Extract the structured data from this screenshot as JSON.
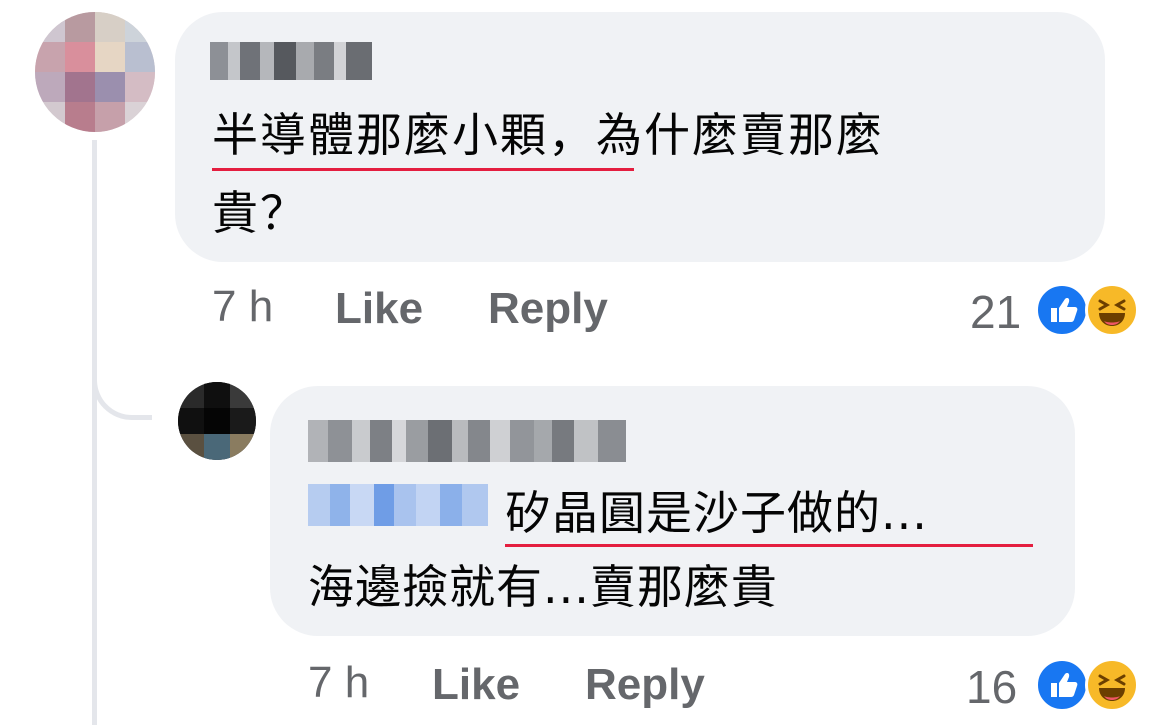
{
  "comment": {
    "text_line1": "半導體那麼小顆，為什麼賣那麼",
    "text_line2": "貴？",
    "time": "7 h",
    "like_label": "Like",
    "reply_label": "Reply",
    "reaction_count": "21",
    "reactions": [
      "like-icon",
      "haha-icon"
    ]
  },
  "reply": {
    "text_line1": "矽晶圓是沙子做的...",
    "text_line2": "海邊撿就有...賣那麼貴",
    "time": "7 h",
    "like_label": "Like",
    "reply_label": "Reply",
    "reaction_count": "16",
    "reactions": [
      "like-icon",
      "haha-icon"
    ]
  },
  "colors": {
    "bubble": "#f0f2f5",
    "meta_text": "#65676b",
    "like_blue": "#1877f2",
    "haha_yellow": "#f7b928",
    "underline_red": "#e41e3f"
  }
}
